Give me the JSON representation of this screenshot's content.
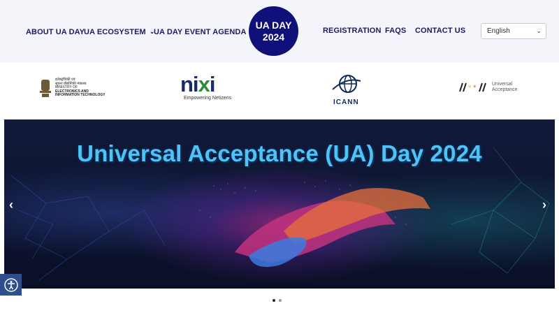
{
  "nav": {
    "about": "ABOUT UA DAY",
    "ecosystem": "UA ECOSYSTEM",
    "agenda": "UA DAY EVENT AGENDA",
    "registration": "REGISTRATION",
    "faqs": "FAQS",
    "contact": "CONTACT US"
  },
  "logo": {
    "line1": "UA DAY",
    "line2": "2024"
  },
  "language": {
    "selected": "English"
  },
  "partners": {
    "meity": {
      "line1": "इलेक्ट्रॉनिकी एवं",
      "line2": "सूचना प्रौद्योगिकी मंत्रालय",
      "line3": "MINISTRY OF",
      "line4": "ELECTRONICS AND",
      "line5": "INFORMATION TECHNOLOGY"
    },
    "nixi": {
      "name": "nixi",
      "tagline": "Empowering Netizens"
    },
    "icann": {
      "name": "ICANN"
    },
    "ua": {
      "line1": "Universal",
      "line2": "Acceptance"
    }
  },
  "banner": {
    "title": "Universal Acceptance (UA) Day 2024"
  },
  "icons": {
    "prev": "chevron-left-icon",
    "next": "chevron-right-icon",
    "dropdown": "chevron-down-icon",
    "accessibility": "accessibility-icon"
  },
  "colors": {
    "nav_text": "#1d1b5e",
    "logo_bg": "#10107a",
    "banner_title": "#4fc3f7",
    "accessibility_bg": "#2d4d8d"
  }
}
